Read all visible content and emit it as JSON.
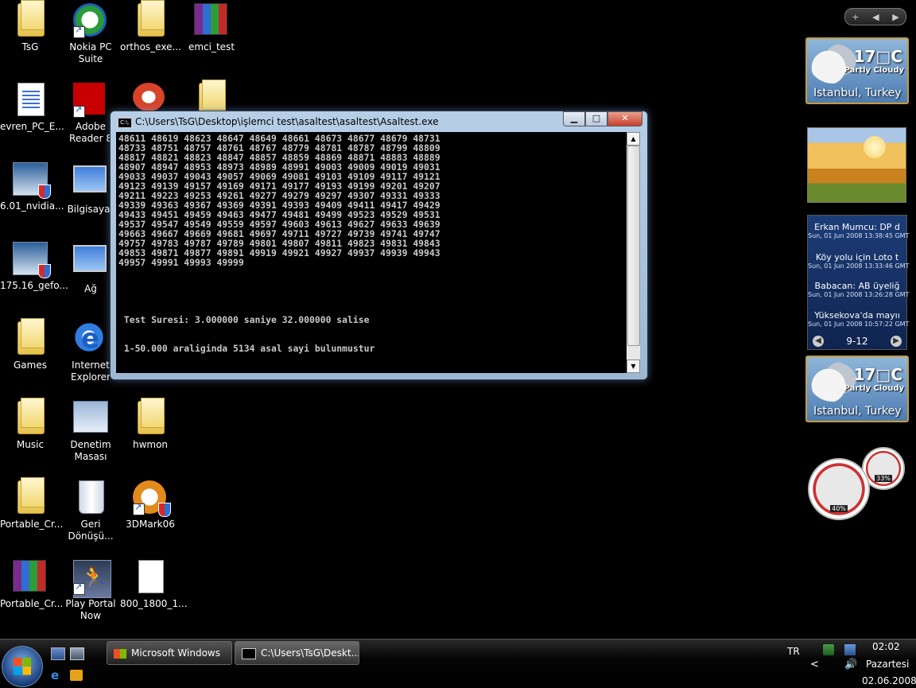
{
  "desktop_icons": [
    {
      "label": "TsG"
    },
    {
      "label": "Nokia PC Suite"
    },
    {
      "label": "orthos_exe..."
    },
    {
      "label": "emci_test"
    },
    {
      "label": "evren_PC_E..."
    },
    {
      "label": "Adobe Reader 8"
    },
    {
      "label": "6.01_nvidia..."
    },
    {
      "label": "Bilgisayar"
    },
    {
      "label": "175.16_gefo..."
    },
    {
      "label": "Ağ"
    },
    {
      "label": "Games"
    },
    {
      "label": "Internet Explorer"
    },
    {
      "label": "Music"
    },
    {
      "label": "Denetim Masası"
    },
    {
      "label": "hwmon"
    },
    {
      "label": "Portable_Cr..."
    },
    {
      "label": "Geri Dönüşü..."
    },
    {
      "label": "3DMark06"
    },
    {
      "label": "Portable_Cr..."
    },
    {
      "label": "Play Portal Now"
    },
    {
      "label": "800_1800_1..."
    }
  ],
  "console": {
    "title": "C:\\Users\\TsG\\Desktop\\işlemci test\\asaltest\\asaltest\\Asaltest.exe",
    "icon_text": "C:\\.",
    "buttons": {
      "minimize": "▁",
      "maximize": "□",
      "close": "✕"
    },
    "output": "48611 48619 48623 48647 48649 48661 48673 48677 48679 48731\n48733 48751 48757 48761 48767 48779 48781 48787 48799 48809\n48817 48821 48823 48847 48857 48859 48869 48871 48883 48889\n48907 48947 48953 48973 48989 48991 49003 49009 49019 49031\n49033 49037 49043 49057 49069 49081 49103 49109 49117 49121\n49123 49139 49157 49169 49171 49177 49193 49199 49201 49207\n49211 49223 49253 49261 49277 49279 49297 49307 49331 49333\n49339 49363 49367 49369 49391 49393 49409 49411 49417 49429\n49433 49451 49459 49463 49477 49481 49499 49523 49529 49531\n49537 49547 49549 49559 49597 49603 49613 49627 49633 49639\n49663 49667 49669 49681 49697 49711 49727 49739 49741 49747\n49757 49783 49787 49789 49801 49807 49811 49823 49831 49843\n49853 49871 49877 49891 49919 49921 49927 49937 49939 49943\n49957 49991 49993 49999\n\n\n\n\n\n Test Suresi: 3.000000 saniye 32.000000 salise\n\n\n 1-50.000 araliginda 5134 asal sayi bulunmustur"
  },
  "sidebar": {
    "controls": {
      "add": "+",
      "prev": "◀",
      "next": "▶"
    },
    "weather_top": {
      "temp": "17□C",
      "condition": "Partly Cloudy",
      "city": "Istanbul, Turkey"
    },
    "weather_bottom": {
      "temp": "17□C",
      "condition": "Partly Cloudy",
      "city": "Istanbul, Turkey"
    },
    "feed": {
      "items": [
        {
          "headline": "Erkan Mumcu: DP d",
          "date": "Sun, 01 Jun 2008 13:38:45 GMT"
        },
        {
          "headline": "Köy yolu için Loto t",
          "date": "Sun, 01 Jun 2008 13:33:46 GMT"
        },
        {
          "headline": "Babacan: AB üyeliğ",
          "date": "Sun, 01 Jun 2008 13:26:28 GMT"
        },
        {
          "headline": "Yüksekova'da mayıı",
          "date": "Sun, 01 Jun 2008 10:57:22 GMT"
        }
      ],
      "pager": "9-12",
      "prev": "◀",
      "next": "▶"
    },
    "cpu_meter": {
      "cpu_percent": "40%",
      "ram_percent": "33%"
    }
  },
  "taskbar": {
    "tasks": [
      {
        "label": "Microsoft Windows"
      },
      {
        "label": "C:\\Users\\TsG\\Deskt..."
      }
    ],
    "language": "TR",
    "chevron": "<",
    "time": "02:02",
    "day": "Pazartesi",
    "date": "02.06.2008"
  }
}
